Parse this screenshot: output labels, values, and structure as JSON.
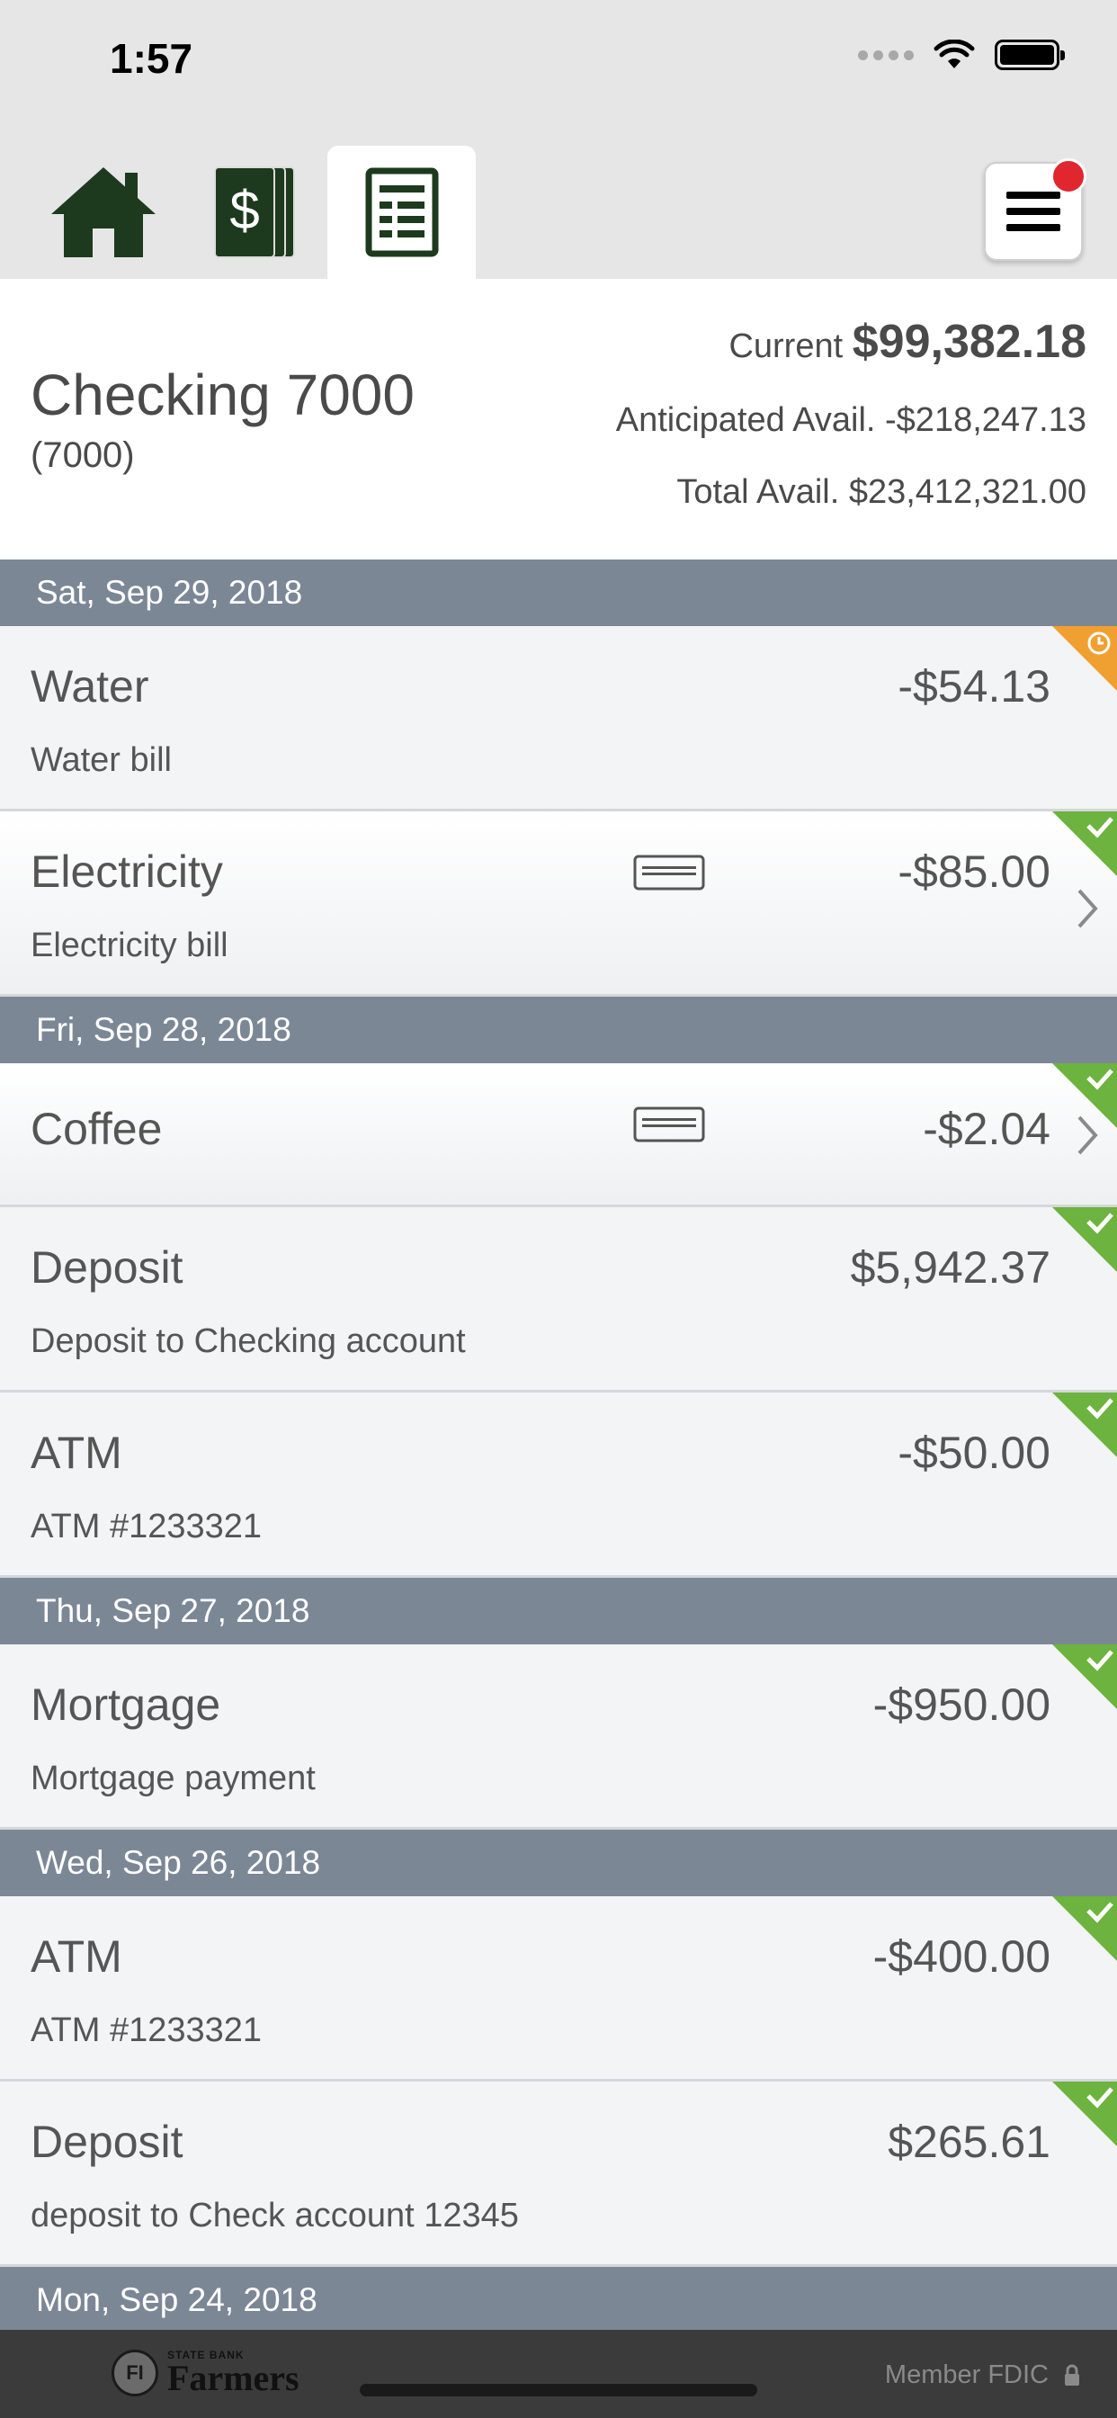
{
  "status_bar": {
    "time": "1:57"
  },
  "nav": {
    "tabs": [
      {
        "icon": "home-icon"
      },
      {
        "icon": "money-icon"
      },
      {
        "icon": "register-icon",
        "active": true
      }
    ],
    "menu_icon": "hamburger-menu-icon",
    "has_notification": true
  },
  "account": {
    "name": "Checking 7000",
    "number": "(7000)",
    "current_label": "Current",
    "current_value": "$99,382.18",
    "anticipated_label": "Anticipated Avail.",
    "anticipated_value": "-$218,247.13",
    "total_label": "Total Avail.",
    "total_value": "$23,412,321.00"
  },
  "groups": [
    {
      "date": "Sat, Sep 29, 2018",
      "transactions": [
        {
          "title": "Water",
          "description": "Water bill",
          "amount": "-$54.13",
          "status": "pending"
        },
        {
          "title": "Electricity",
          "description": "Electricity bill",
          "amount": "-$85.00",
          "status": "cleared",
          "card": true,
          "details": true
        }
      ]
    },
    {
      "date": "Fri, Sep 28, 2018",
      "transactions": [
        {
          "title": "Coffee",
          "description": "",
          "amount": "-$2.04",
          "status": "cleared",
          "card": true,
          "details": true
        },
        {
          "title": "Deposit",
          "description": "Deposit to Checking account",
          "amount": "$5,942.37",
          "status": "cleared"
        },
        {
          "title": "ATM",
          "description": "ATM #1233321",
          "amount": "-$50.00",
          "status": "cleared"
        }
      ]
    },
    {
      "date": "Thu, Sep 27, 2018",
      "transactions": [
        {
          "title": "Mortgage",
          "description": "Mortgage payment",
          "amount": "-$950.00",
          "status": "cleared"
        }
      ]
    },
    {
      "date": "Wed, Sep 26, 2018",
      "transactions": [
        {
          "title": "ATM",
          "description": "ATM #1233321",
          "amount": "-$400.00",
          "status": "cleared"
        },
        {
          "title": "Deposit",
          "description": "deposit to Check account 12345",
          "amount": "$265.61",
          "status": "cleared"
        }
      ]
    },
    {
      "date": "Mon, Sep 24, 2018",
      "transactions": []
    }
  ],
  "footer": {
    "logo_small": "STATE BANK",
    "logo_big": "Farmers",
    "fdic": "Member FDIC",
    "lock_icon": "lock-icon"
  },
  "colors": {
    "date_header": "#7c8796",
    "cleared": "#6db33f",
    "pending": "#f0a030",
    "icon_green": "#1e3a1e",
    "badge": "#e0262e"
  }
}
